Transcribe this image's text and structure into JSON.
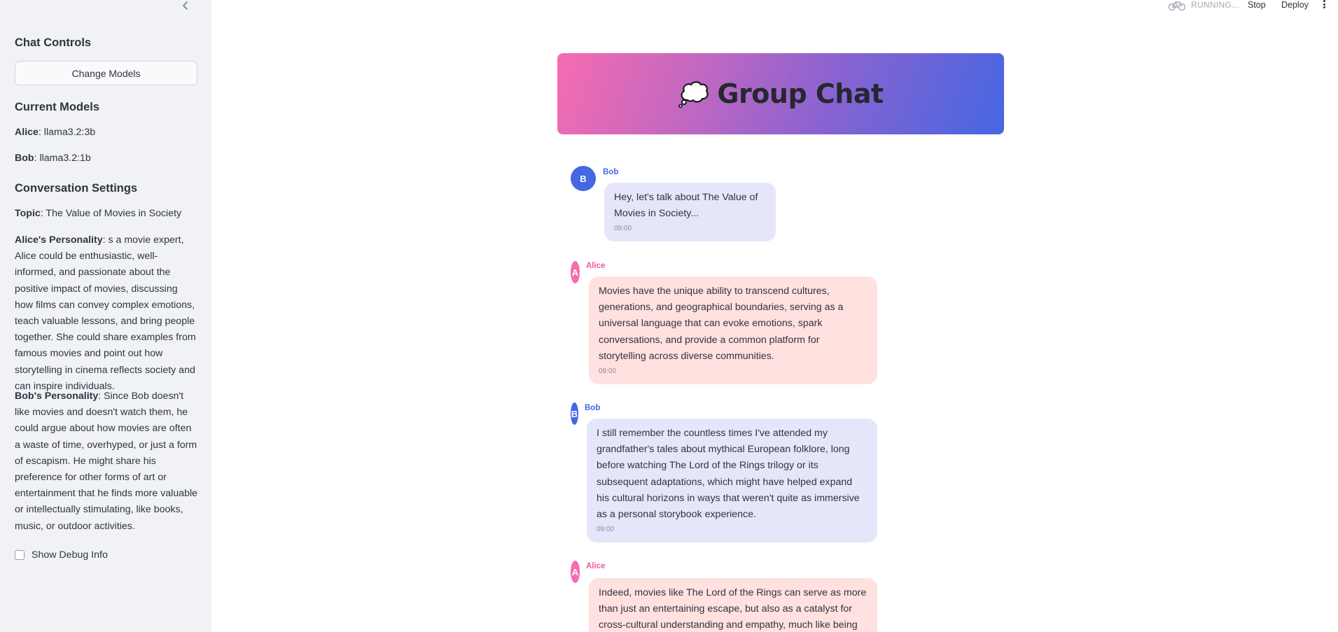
{
  "sidebar": {
    "collapse_icon": "chevron-left-icon",
    "chat_controls_title": "Chat Controls",
    "change_models_label": "Change Models",
    "current_models_title": "Current Models",
    "alice_model_label": "Alice",
    "alice_model_value": ": llama3.2:3b",
    "bob_model_label": "Bob",
    "bob_model_value": ": llama3.2:1b",
    "conversation_settings_title": "Conversation Settings",
    "topic_label": "Topic",
    "topic_value": ": The Value of Movies in Society",
    "alice_personality_label": "Alice's Personality",
    "alice_personality_value": ": s a movie expert, Alice could be enthusiastic, well-informed, and passionate about the positive impact of movies, discussing how films can convey complex emotions, teach valuable lessons, and bring people together. She could share examples from famous movies and point out how storytelling in cinema reflects society and can inspire individuals.",
    "bob_personality_label": "Bob's Personality",
    "bob_personality_value": ": Since Bob doesn't like movies and doesn't watch them, he could argue about how movies are often a waste of time, overhyped, or just a form of escapism. He might share his preference for other forms of art or entertainment that he finds more valuable or intellectually stimulating, like books, music, or outdoor activities.",
    "debug_label": "Show Debug Info"
  },
  "topbar": {
    "status": "RUNNING...",
    "stop_label": "Stop",
    "deploy_label": "Deploy",
    "running_icon": "bicycle-icon",
    "menu_icon": "kebab-menu-icon"
  },
  "header": {
    "title": "Group Chat",
    "icon": "thought-bubble-icon"
  },
  "colors": {
    "bob": "#4567e2",
    "alice": "#f56cb0",
    "bob_bubble": "#e6e6fa",
    "alice_bubble": "#ffe1df"
  },
  "messages": [
    {
      "sender": "Bob",
      "initial": "B",
      "text": "Hey, let's talk about The Value of Movies in Society...",
      "time": "09:00"
    },
    {
      "sender": "Alice",
      "initial": "A",
      "text": "Movies have the unique ability to transcend cultures, generations, and geographical boundaries, serving as a universal language that can evoke emotions, spark conversations, and provide a common platform for storytelling across diverse communities.",
      "time": "09:00"
    },
    {
      "sender": "Bob",
      "initial": "B",
      "text": "I still remember the countless times I've attended my grandfather's tales about mythical European folklore, long before watching The Lord of the Rings trilogy or its subsequent adaptations, which might have helped expand his cultural horizons in ways that weren't quite as immersive as a personal storybook experience.",
      "time": "09:00"
    },
    {
      "sender": "Alice",
      "initial": "A",
      "text": "Indeed, movies like The Lord of the Rings can serve as more than just an entertaining escape, but also as a catalyst for cross-cultural understanding and empathy, much like being able to",
      "time": ""
    }
  ]
}
